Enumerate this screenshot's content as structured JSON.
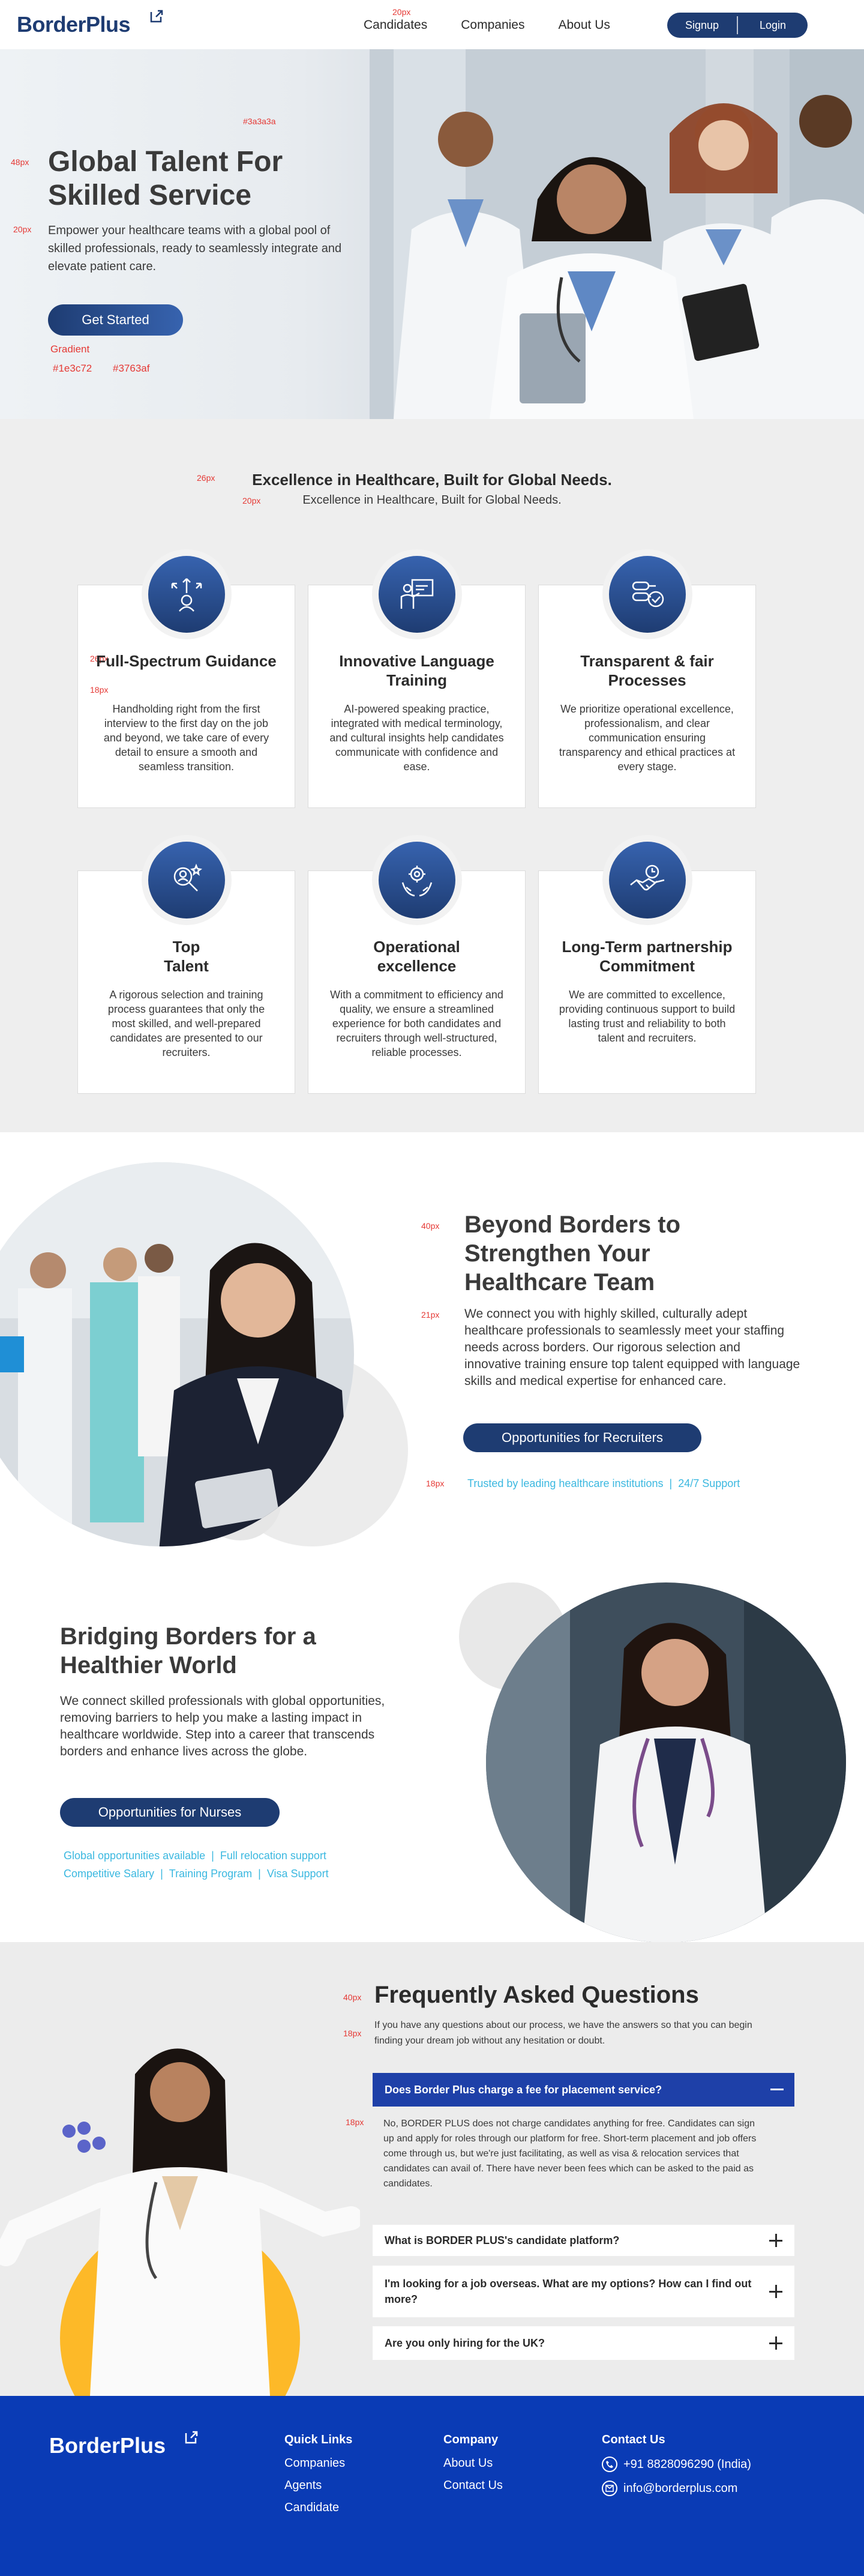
{
  "nav": {
    "logo": "BorderPlus",
    "links": [
      "Candidates",
      "Companies",
      "About Us"
    ],
    "signup": "Signup",
    "login": "Login"
  },
  "annotations": {
    "nav_size": "20px",
    "hero_color": "#3a3a3a",
    "hero_title_size": "48px",
    "hero_sub_size": "20px",
    "gradient_label": "Gradient",
    "gradient_from": "#1e3c72",
    "gradient_to": "#3763af",
    "ex_title_size": "26px",
    "ex_sub_size": "20px",
    "card_title_size": "26px",
    "card_text_size": "18px",
    "beyond_title_size": "40px",
    "beyond_text_size": "21px",
    "chips_size": "18px",
    "faq_title_size": "40px",
    "faq_sub_size": "18px",
    "faq_answer_size": "18px"
  },
  "hero": {
    "title": "Global Talent For Skilled Service",
    "subtitle": "Empower your healthcare teams with a global pool of skilled professionals, ready to seamlessly integrate and elevate patient care.",
    "cta": "Get Started"
  },
  "excellence": {
    "title": "Excellence in Healthcare, Built for Global Needs.",
    "subtitle": "Excellence in Healthcare, Built for Global Needs.",
    "cards": [
      {
        "title": "Full-Spectrum Guidance",
        "text": "Handholding right from the first interview to the first day on the job and beyond, we take care of every detail to ensure a smooth and seamless transition.",
        "icon": "guidance-icon"
      },
      {
        "title": "Innovative Language Training",
        "text": "AI-powered speaking practice, integrated with medical terminology, and cultural insights help candidates communicate with confidence and ease.",
        "icon": "language-training-icon"
      },
      {
        "title": "Transparent & fair Processes",
        "text": "We prioritize operational excellence, professionalism, and clear communication ensuring transparency and ethical practices at every stage.",
        "icon": "process-icon"
      },
      {
        "title": "Top Talent",
        "text": "A rigorous selection and training process guarantees that only the most skilled, and well-prepared candidates are presented to our recruiters.",
        "icon": "talent-icon"
      },
      {
        "title": "Operational excellence",
        "text": "With a commitment to efficiency and quality, we ensure a streamlined experience for both candidates and recruiters through well-structured, reliable processes.",
        "icon": "excellence-icon"
      },
      {
        "title": "Long-Term partnership Commitment",
        "text": "We are committed to excellence, providing continuous support to build lasting trust and reliability to both talent and recruiters.",
        "icon": "handshake-icon"
      }
    ]
  },
  "beyond": {
    "title": "Beyond Borders to Strengthen Your Healthcare Team",
    "text": "We connect you with highly skilled, culturally adept healthcare professionals to seamlessly meet your staffing needs across borders. Our rigorous selection and innovative training ensure top talent equipped with language skills and medical expertise for enhanced care.",
    "cta": "Opportunities for Recruiters",
    "chips": [
      "Trusted by leading healthcare institutions",
      "24/7 Support"
    ]
  },
  "bridging": {
    "title": "Bridging Borders for a Healthier World",
    "text": "We connect skilled professionals with global opportunities, removing barriers to help you make a lasting impact in healthcare worldwide. Step into a career that transcends borders and enhance lives across the globe.",
    "cta": "Opportunities for Nurses",
    "chips_row1": [
      "Global opportunities available",
      "Full relocation support"
    ],
    "chips_row2": [
      "Competitive Salary",
      "Training Program",
      "Visa Support"
    ]
  },
  "faq": {
    "title": "Frequently Asked Questions",
    "subtitle": "If you have any questions about our process, we have the answers so that you can begin finding your dream job without any hesitation or doubt.",
    "open_question": "Does Border Plus charge a fee for placement service?",
    "open_answer": "No, BORDER PLUS does not charge candidates anything for free. Candidates can sign up and apply for roles through our platform for free. Short-term placement and job offers come through us, but we're just facilitating, as well as visa & relocation services that candidates can avail of. There have never been fees which can be asked to the paid as candidates.",
    "questions": [
      "What is BORDER PLUS's candidate platform?",
      "I'm looking for a job overseas. What are my options? How can I find out more?",
      "Are you only hiring for the UK?"
    ]
  },
  "footer": {
    "logo": "BorderPlus",
    "quick_links": {
      "title": "Quick Links",
      "items": [
        "Companies",
        "Agents",
        "Candidate"
      ]
    },
    "company": {
      "title": "Company",
      "items": [
        "About Us",
        "Contact Us"
      ]
    },
    "contact": {
      "title": "Contact Us",
      "phone": "+91 8828096290 (India)",
      "email": "info@borderplus.com"
    }
  }
}
